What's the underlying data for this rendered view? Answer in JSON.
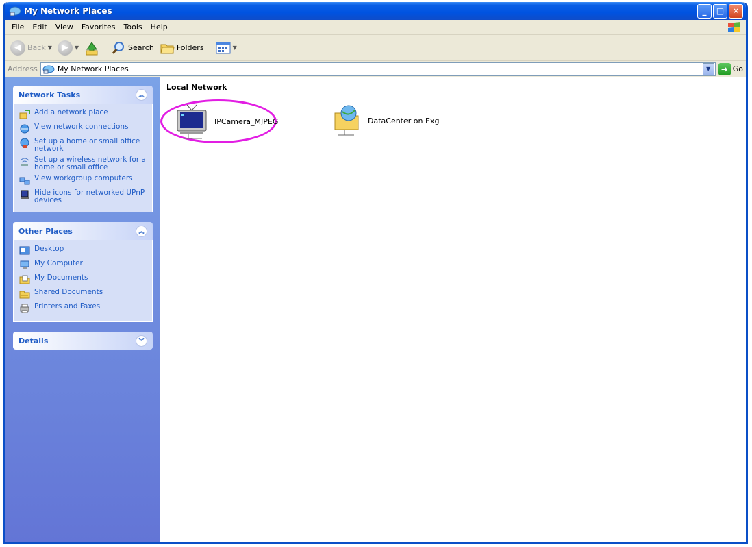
{
  "window": {
    "title": "My Network Places"
  },
  "menubar": {
    "items": [
      "File",
      "Edit",
      "View",
      "Favorites",
      "Tools",
      "Help"
    ]
  },
  "toolbar": {
    "back_label": "Back",
    "search_label": "Search",
    "folders_label": "Folders"
  },
  "address": {
    "label": "Address",
    "value": "My Network Places",
    "go_label": "Go"
  },
  "sidebar": {
    "network_tasks": {
      "title": "Network Tasks",
      "items": [
        "Add a network place",
        "View network connections",
        "Set up a home or small office network",
        "Set up a wireless network for a home or small office",
        "View workgroup computers",
        "Hide icons for networked UPnP devices"
      ]
    },
    "other_places": {
      "title": "Other Places",
      "items": [
        "Desktop",
        "My Computer",
        "My Documents",
        "Shared Documents",
        "Printers and Faxes"
      ]
    },
    "details": {
      "title": "Details"
    }
  },
  "content": {
    "group_title": "Local Network",
    "items": [
      "IPCamera_MJPEG",
      "DataCenter on Exg"
    ]
  },
  "colors": {
    "titlebar": "#0053e0",
    "sidebar": "#6f8fe0",
    "task_link": "#215dc6",
    "highlight": "#e21ee3"
  }
}
